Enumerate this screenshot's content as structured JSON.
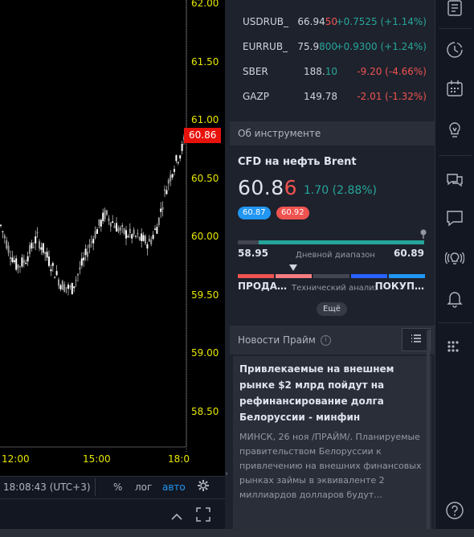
{
  "chart": {
    "price_ticks": [
      "62.00",
      "61.50",
      "61.00",
      "60.50",
      "60.00",
      "59.50",
      "59.00",
      "58.50"
    ],
    "time_ticks": [
      "12:00",
      "15:00",
      "18:0"
    ],
    "current_price": "60.86"
  },
  "toolbar": {
    "time": "18:08:43 (UTC+3)",
    "percent": "%",
    "log": "лог",
    "auto": "авто"
  },
  "watchlist": [
    {
      "symbol": "USDRUB_",
      "last_main": "66.94",
      "last_frac": "50",
      "frac_dir": "dn",
      "change": "+0.7525 (+1.14%)",
      "dir": "up"
    },
    {
      "symbol": "EURRUB_",
      "last_main": "75.9",
      "last_frac": "800",
      "frac_dir": "up",
      "change": "+0.9300 (+1.24%)",
      "dir": "up"
    },
    {
      "symbol": "SBER",
      "last_main": "188.",
      "last_frac": "10",
      "frac_dir": "up",
      "change": "-9.20 (-4.66%)",
      "dir": "dn"
    },
    {
      "symbol": "GAZP",
      "last_main": "149.78",
      "last_frac": "",
      "frac_dir": "dn",
      "change": "-2.01 (-1.32%)",
      "dir": "dn"
    }
  ],
  "instrument": {
    "header": "Об инструменте",
    "name": "CFD на нефть Brent",
    "price_main": "60.8",
    "price_last": "6",
    "change": "1.70 (2.88%)",
    "bid": "60.87",
    "ask": "60.92",
    "range_low": "58.95",
    "range_high": "60.89",
    "range_caption": "Дневной диапазон",
    "tech_sell": "ПРОДА…",
    "tech_caption": "Технический анализ",
    "tech_buy": "ПОКУП…",
    "more": "Ещё"
  },
  "news": {
    "header": "Новости Прайм",
    "title": "Привлекаемые на внешнем рынке $2 млрд пойдут на рефинансирование долга Белоруссии - минфин",
    "body": "МИНСК, 26 ноя /ПРАЙМ/. Планируемые правительством Белоруссии к привлечению на внешних финансовых рынках займы в эквиваленте 2 миллиардов долларов будут..."
  },
  "colors": {
    "up": "#26a69a",
    "down": "#ef5350",
    "axis_text": "#e6e600",
    "price_tag": "#e8120c",
    "accent_blue": "#2196f3"
  },
  "icons": [
    "news-icon",
    "clock-icon",
    "calendar-icon",
    "idea-bulb-icon",
    "chat-icon",
    "chat-single-icon",
    "broadcast-icon",
    "bell-icon",
    "grid-dots-icon",
    "help-icon"
  ]
}
